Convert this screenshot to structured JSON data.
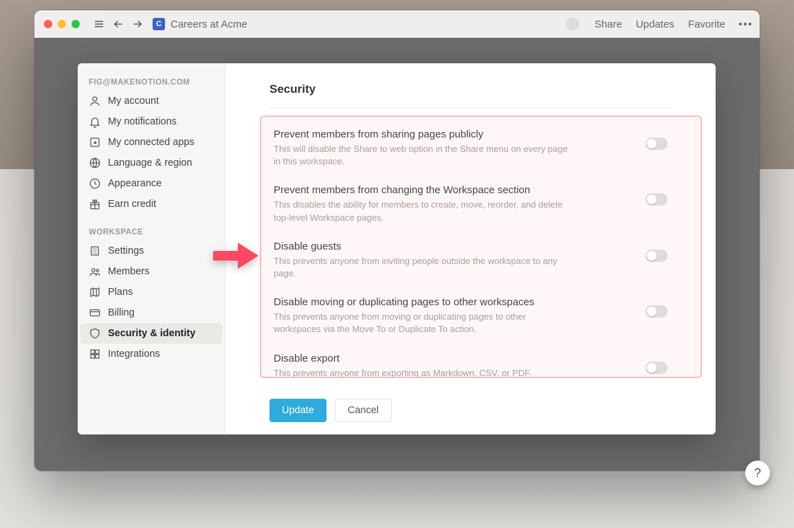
{
  "titlebar": {
    "page_badge": "C",
    "page_title": "Careers at Acme",
    "share": "Share",
    "updates": "Updates",
    "favorite": "Favorite"
  },
  "sidebar": {
    "account_section": "FIG@MAKENOTION.COM",
    "workspace_section": "WORKSPACE",
    "items": {
      "my_account": "My account",
      "my_notifications": "My notifications",
      "my_connected_apps": "My connected apps",
      "language_region": "Language & region",
      "appearance": "Appearance",
      "earn_credit": "Earn credit",
      "settings": "Settings",
      "members": "Members",
      "plans": "Plans",
      "billing": "Billing",
      "security_identity": "Security & identity",
      "integrations": "Integrations"
    }
  },
  "content": {
    "heading": "Security",
    "settings": [
      {
        "title": "Prevent members from sharing pages publicly",
        "desc": "This will disable the Share to web option in the Share menu on every page in this workspace."
      },
      {
        "title": "Prevent members from changing the Workspace section",
        "desc": "This disables the ability for members to create, move, reorder, and delete top-level Workspace pages."
      },
      {
        "title": "Disable guests",
        "desc": "This prevents anyone from inviting people outside the workspace to any page."
      },
      {
        "title": "Disable moving or duplicating pages to other workspaces",
        "desc": "This prevents anyone from moving or duplicating pages to other workspaces via the Move To or Duplicate To action."
      },
      {
        "title": "Disable export",
        "desc": "This prevents anyone from exporting as Markdown, CSV, or PDF."
      }
    ],
    "update_btn": "Update",
    "cancel_btn": "Cancel"
  },
  "help": "?"
}
